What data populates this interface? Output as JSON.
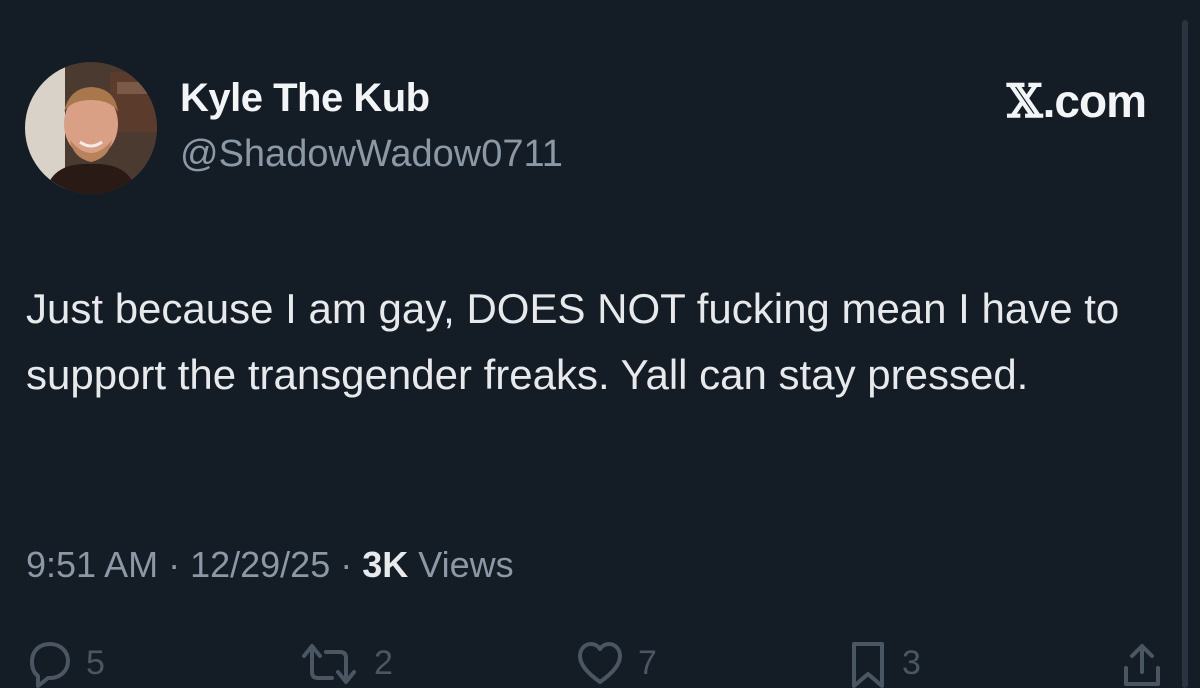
{
  "author": {
    "display_name": "Kyle The Kub",
    "handle": "@ShadowWadow0711",
    "avatar_icon": "profile-photo"
  },
  "brand": {
    "mark": "𝕏",
    "label": ".com"
  },
  "tweet": {
    "text": "Just because I am gay, DOES NOT fucking mean I have to support the transgender freaks. Yall can stay pressed.",
    "time": "9:51 AM",
    "date": "12/29/25",
    "separator": "·",
    "views_count": "3K",
    "views_label": "Views"
  },
  "actions": {
    "replies": "5",
    "reposts": "2",
    "likes": "7",
    "bookmarks": "3"
  },
  "colors": {
    "background": "#141c26",
    "text": "#e7e9ea",
    "secondary": "#8b98a5",
    "action_icons": "#4a5662"
  }
}
